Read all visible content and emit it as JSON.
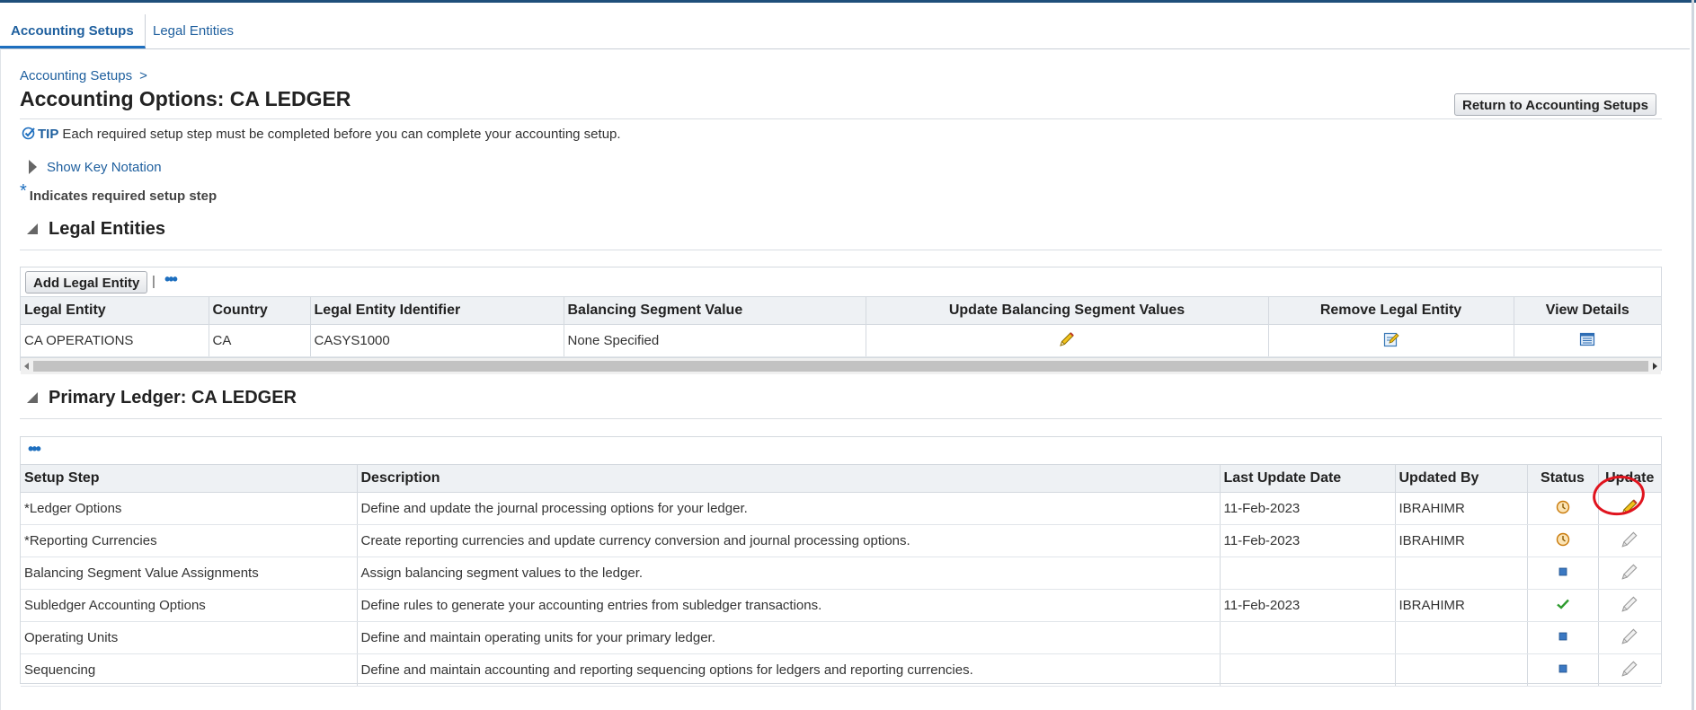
{
  "tabs": [
    {
      "label": "Accounting Setups",
      "active": true
    },
    {
      "label": "Legal Entities",
      "active": false
    }
  ],
  "breadcrumb": {
    "link": "Accounting Setups",
    "separator": ">"
  },
  "page_title": "Accounting Options: CA LEDGER",
  "return_button": "Return to Accounting Setups",
  "tip": {
    "label": "TIP",
    "text": "Each required setup step must be completed before you can complete your accounting setup."
  },
  "key_notation": "Show Key Notation",
  "required_note": {
    "star": "*",
    "text": "Indicates required setup step"
  },
  "legal_entities": {
    "heading": "Legal Entities",
    "add_button": "Add Legal Entity",
    "toolbar_separator": "|",
    "more_dots": "•••",
    "columns": [
      "Legal Entity",
      "Country",
      "Legal Entity Identifier",
      "Balancing Segment Value",
      "Update Balancing Segment Values",
      "Remove Legal Entity",
      "View Details"
    ],
    "rows": [
      {
        "legal_entity": "CA OPERATIONS",
        "country": "CA",
        "identifier": "CASYS1000",
        "balancing_segment": "None Specified"
      }
    ]
  },
  "primary_ledger": {
    "heading": "Primary Ledger: CA LEDGER",
    "more_dots": "•••",
    "columns": [
      "Setup Step",
      "Description",
      "Last Update Date",
      "Updated By",
      "Status",
      "Update"
    ],
    "rows": [
      {
        "step": "*Ledger Options",
        "description": "Define and update the journal processing options for your ledger.",
        "date": "11-Feb-2023",
        "by": "IBRAHIMR",
        "status": "in-progress-icon",
        "update": "pencil-active-icon"
      },
      {
        "step": "*Reporting Currencies",
        "description": "Create reporting currencies and update currency conversion and journal processing options.",
        "date": "11-Feb-2023",
        "by": "IBRAHIMR",
        "status": "in-progress-icon",
        "update": "pencil-disabled-icon"
      },
      {
        "step": "Balancing Segment Value Assignments",
        "description": "Assign balancing segment values to the ledger.",
        "date": "",
        "by": "",
        "status": "not-started-icon",
        "update": "pencil-disabled-icon"
      },
      {
        "step": "Subledger Accounting Options",
        "description": "Define rules to generate your accounting entries from subledger transactions.",
        "date": "11-Feb-2023",
        "by": "IBRAHIMR",
        "status": "complete-check-icon",
        "update": "pencil-disabled-icon"
      },
      {
        "step": "Operating Units",
        "description": "Define and maintain operating units for your primary ledger.",
        "date": "",
        "by": "",
        "status": "not-started-icon",
        "update": "pencil-disabled-icon"
      },
      {
        "step": "Sequencing",
        "description": "Define and maintain accounting and reporting sequencing options for ledgers and reporting currencies.",
        "date": "",
        "by": "",
        "status": "not-started-icon",
        "update": "pencil-disabled-icon"
      }
    ]
  },
  "colors": {
    "link": "#1e5f9e",
    "accent": "#1e6fbf",
    "annotation_circle": "#e0141e"
  }
}
